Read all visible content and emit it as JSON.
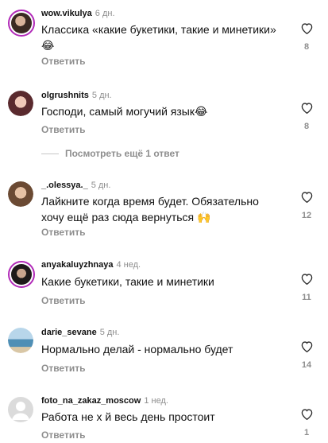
{
  "comments": [
    {
      "username": "wow.vikulya",
      "time": "6 дн.",
      "text": "Классика «какие букетики, такие и минетики» 😂",
      "reply": "Ответить",
      "likes": "8"
    },
    {
      "username": "olgrushnits",
      "time": "5 дн.",
      "text": "Господи, самый могучий язык😂",
      "reply": "Ответить",
      "likes": "8"
    },
    {
      "username": "_.olessya._",
      "time": "5 дн.",
      "text": "Лайкните когда время будет. Обязательно хочу ещё раз сюда вернуться 🙌",
      "reply": "Ответить",
      "likes": "12"
    },
    {
      "username": "anyakaluyzhnaya",
      "time": "4 нед.",
      "text": "Какие букетики, такие и минетики",
      "reply": "Ответить",
      "likes": "11"
    },
    {
      "username": "darie_sevane",
      "time": "5 дн.",
      "text": "Нормально делай - нормально будет",
      "reply": "Ответить",
      "likes": "14"
    },
    {
      "username": "foto_na_zakaz_moscow",
      "time": "1 нед.",
      "text": "Работа не х  й весь день простоит",
      "reply": "Ответить",
      "likes": "1"
    }
  ],
  "view_more": "Посмотреть ещё 1 ответ",
  "icons": {
    "like": "heart-outline-icon"
  },
  "colors": {
    "story_ring": "#b12ab8",
    "secondary_text": "#8e8e8e"
  }
}
